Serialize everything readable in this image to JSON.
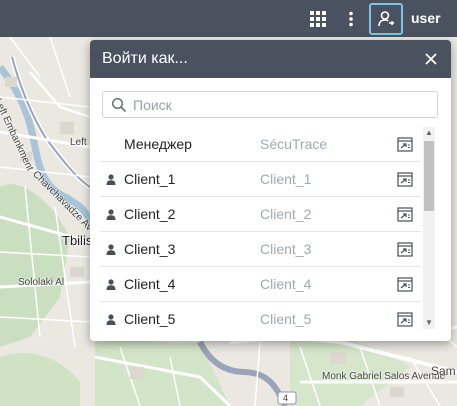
{
  "topbar": {
    "apps_icon": "grid-icon",
    "menu_icon": "vertical-dots-icon",
    "user_icon": "user-icon",
    "username": "user"
  },
  "map": {
    "labels": {
      "left_embankment": "Left Embankment",
      "left_short": "Left",
      "chavchavadze": "Chavchavadze Avenue",
      "tbilisi": "Tbilisi",
      "sololaki": "Sololaki Al",
      "monk_gabriel": "Monk Gabriel Salos Avenue",
      "sam": "Sam",
      "route": "4",
      "route2": "4"
    }
  },
  "dialog": {
    "title": "Войти как...",
    "close_icon": "close-icon",
    "search_placeholder": "Поиск",
    "rows": [
      {
        "name": "Менеджер",
        "sub": "SécuTrace",
        "has_user_icon": false
      },
      {
        "name": "Client_1",
        "sub": "Client_1",
        "has_user_icon": true
      },
      {
        "name": "Client_2",
        "sub": "Client_2",
        "has_user_icon": true
      },
      {
        "name": "Client_3",
        "sub": "Client_3",
        "has_user_icon": true
      },
      {
        "name": "Client_4",
        "sub": "Client_4",
        "has_user_icon": true
      },
      {
        "name": "Client_5",
        "sub": "Client_5",
        "has_user_icon": true
      }
    ]
  },
  "colors": {
    "header_bg": "#4a5260",
    "focus_border": "#7ec3e6",
    "secondary_text": "#a3a8ae"
  }
}
